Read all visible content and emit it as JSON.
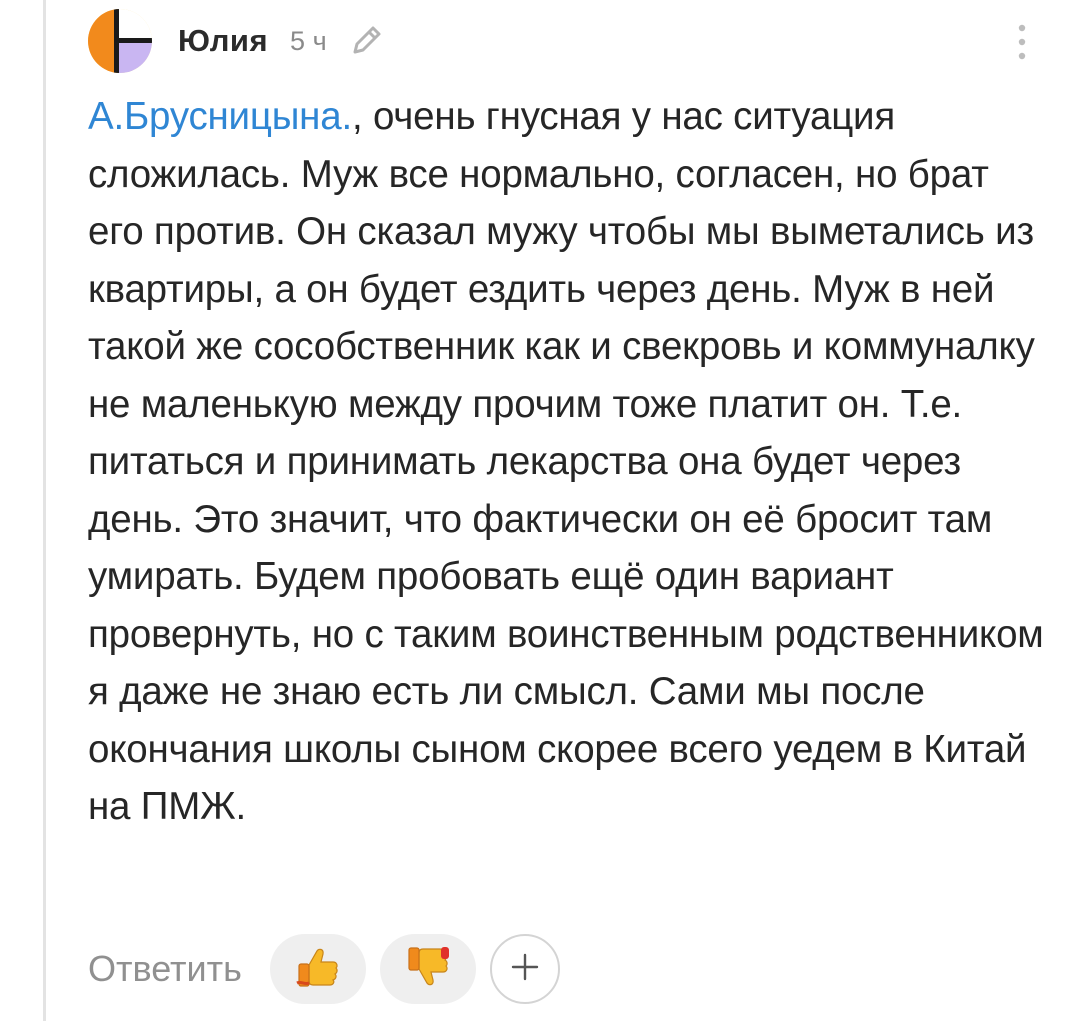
{
  "comment": {
    "author": "Юлия",
    "time": "5 ч",
    "mention": "А.Брусницына.",
    "text": ", очень гнусная у нас ситуация сложилась. Муж все нормально, согласен, но брат его против. Он сказал мужу чтобы мы выметались из квартиры, а он будет ездить через день. Муж в ней такой же сособственник как и свекровь и коммуналку не маленькую между прочим тоже платит он. Т.е. питаться и принимать лекарства она будет через день. Это значит, что фактически он её бросит там умирать. Будем пробовать ещё один вариант провернуть, но с таким воинственным родственником я даже не знаю есть ли смысл. Сами мы после окончания школы сыном скорее всего уедем в Китай на ПМЖ."
  },
  "actions": {
    "reply_label": "Ответить",
    "add_label": "+"
  },
  "icons": {
    "edit": "pencil-icon",
    "menu": "more-vertical-icon",
    "like": "thumbs-up-emoji-icon",
    "dislike": "thumbs-down-emoji-icon"
  },
  "colors": {
    "mention": "#2f86d4",
    "avatar_orange": "#f28a1c",
    "avatar_purple": "#c9b6f2",
    "avatar_yellow": "#fce49a"
  }
}
